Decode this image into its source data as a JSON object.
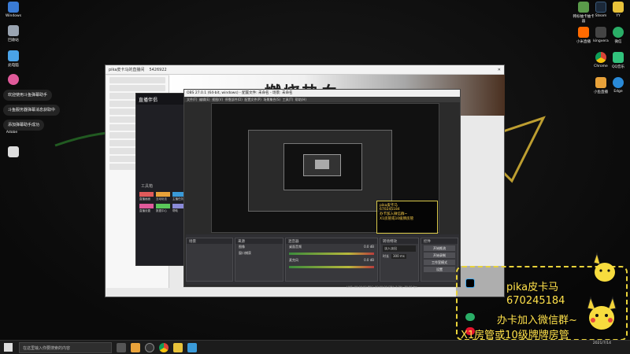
{
  "desktop": {
    "left_icons": [
      {
        "label": "Windows",
        "color": "#3a7bd5"
      },
      {
        "label": "回收站",
        "color": "#9aa4b1"
      },
      {
        "label": "此电脑",
        "color": "#4aa3e8"
      },
      {
        "label": "",
        "color": "#e05a9a"
      }
    ],
    "right_icons": [
      {
        "label": "韩标抽卡抽卡器",
        "color": "#5a9a4a"
      },
      {
        "label": "Steam",
        "color": "#1b2838"
      },
      {
        "label": "YY",
        "color": "#e8c23a"
      },
      {
        "label": "小米直播",
        "color": "#ff6a00"
      },
      {
        "label": "kingvera",
        "color": "#444"
      },
      {
        "label": "微信",
        "color": "#2aae67"
      },
      {
        "label": "Chrome",
        "color": "#e8e8e8"
      },
      {
        "label": "QQ音乐",
        "color": "#31c27c"
      },
      {
        "label": "小鱼直播",
        "color": "#e8a23a"
      },
      {
        "label": "Edge",
        "color": "#2a8ad8"
      }
    ],
    "notifications": [
      "欢迎使用斗鱼弹幕助手",
      "斗鱼服务器弹幕消息获取中",
      "添加弹幕助手成功"
    ],
    "aside_label": "Adobe"
  },
  "browser": {
    "tab_label": "pika皮卡马的直播间",
    "tab2_label": "5426922",
    "banner_text": "燃烧热血"
  },
  "live_app": {
    "title": "直播伴侣",
    "section_label": "工具箱",
    "items": [
      "直播画面",
      "互动玩法",
      "主播任务",
      "直播设置",
      "数据中心",
      "帮助"
    ]
  },
  "obs": {
    "title": "OBS 27.0.1 (64-bit, windows) - 配置文件: 未命名 - 场景: 未命名",
    "menu": [
      "文件(F)",
      "编辑(E)",
      "视图(V)",
      "停靠部件(D)",
      "配置文件(P)",
      "场景集合(S)",
      "工具(T)",
      "帮助(H)"
    ],
    "panel_titles": [
      "场景",
      "来源",
      "混音器",
      "转场特效",
      "控件"
    ],
    "sources": [
      "图像",
      "窗口捕获"
    ],
    "mixer_tracks": [
      {
        "name": "桌面音频",
        "level": "0.0 dB"
      },
      {
        "name": "麦克风",
        "level": "0.0 dB"
      }
    ],
    "controls": [
      "开始推流",
      "开始录制",
      "工作室模式",
      "设置",
      "退出"
    ],
    "transition": "淡入淡出",
    "duration_label": "时长",
    "duration_value": "300 ms",
    "status": "LIVE: 00:00:00  REC: 00:00:00  CPU: 5.3%, 30.00 fps"
  },
  "chat_box": {
    "lines": [
      "pika皮卡马",
      "670245184",
      "办卡加入微信群~",
      "X1房管或10级牌房管"
    ]
  },
  "overlay": {
    "name": "pika皮卡马",
    "id": "670245184",
    "line3": "办卡加入微信群~",
    "line4": "X1房管或10级牌牌房管"
  },
  "taskbar": {
    "search_placeholder": "在这里输入你要搜索的内容",
    "time": "",
    "date": "2021/7/14"
  }
}
